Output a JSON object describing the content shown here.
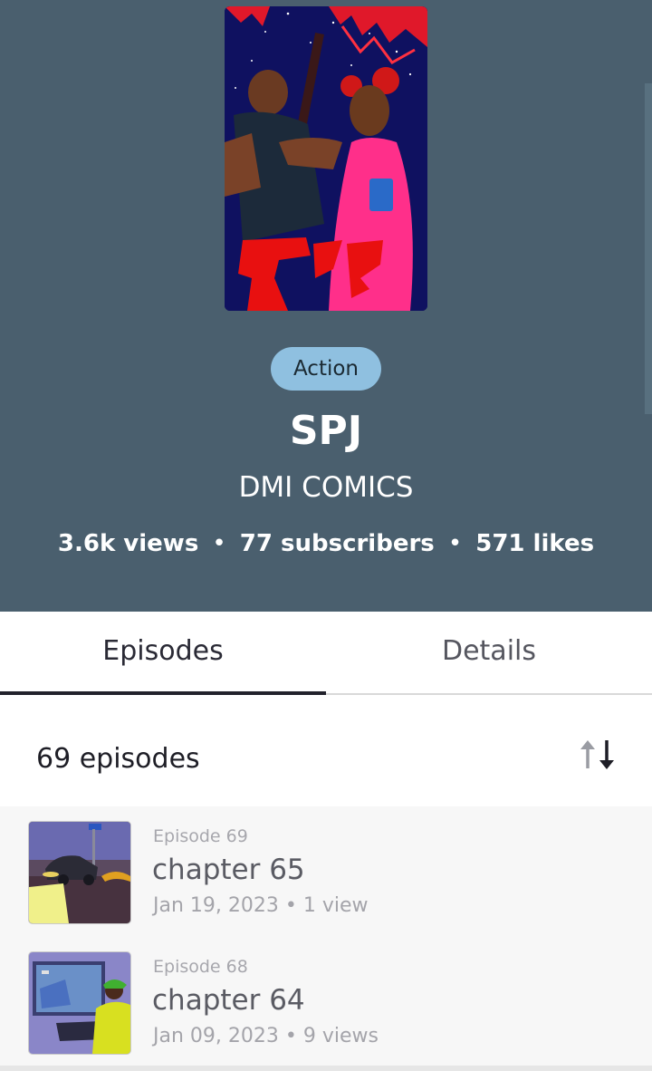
{
  "series": {
    "genre": "Action",
    "title": "SPJ",
    "author": "DMI COMICS",
    "stats": {
      "views": "3.6k views",
      "subscribers": "77 subscribers",
      "likes": "571 likes",
      "separator": "•"
    },
    "cover_art": "cover-illustration"
  },
  "tabs": [
    {
      "label": "Episodes",
      "active": true
    },
    {
      "label": "Details",
      "active": false
    }
  ],
  "episodes_header": {
    "count_label": "69 episodes",
    "sort_icon": "sort-arrows-icon"
  },
  "episodes": [
    {
      "number": "Episode 69",
      "title": "chapter 65",
      "date": "Jan 19, 2023",
      "views": "1 view"
    },
    {
      "number": "Episode 68",
      "title": "chapter 64",
      "date": "Jan 09, 2023",
      "views": "9 views"
    }
  ],
  "colors": {
    "hero_bg": "#4a5f6e",
    "genre_pill": "#8fc0e0",
    "tab_indicator": "#22222c",
    "list_bg": "#f7f7f7"
  }
}
